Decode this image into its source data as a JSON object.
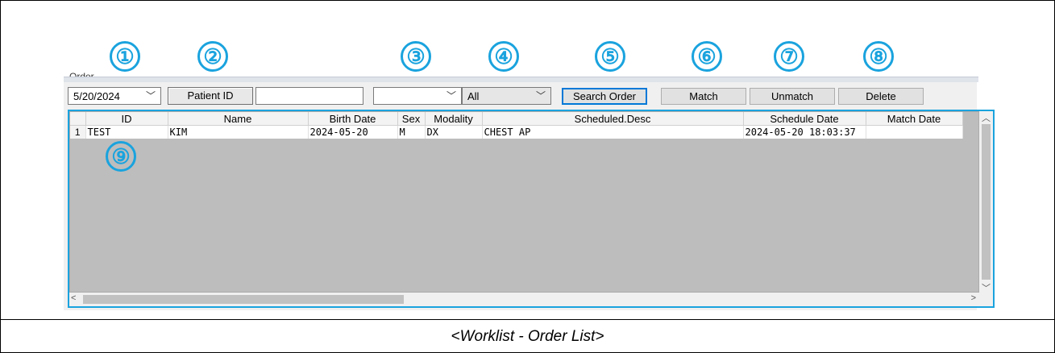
{
  "panel_title": "Order",
  "toolbar": {
    "date_value": "5/20/2024",
    "patient_id_label": "Patient ID",
    "patient_id_value": "",
    "filter1_value": "",
    "filter2_value": "All",
    "search_label": "Search Order",
    "match_label": "Match",
    "unmatch_label": "Unmatch",
    "delete_label": "Delete"
  },
  "callouts": [
    "①",
    "②",
    "③",
    "④",
    "⑤",
    "⑥",
    "⑦",
    "⑧",
    "⑨"
  ],
  "grid": {
    "columns": [
      "ID",
      "Name",
      "Birth Date",
      "Sex",
      "Modality",
      "Scheduled.Desc",
      "Schedule Date",
      "Match Date"
    ],
    "rows": [
      {
        "num": "1",
        "cells": [
          "TEST",
          "KIM",
          "2024-05-20",
          "M",
          "DX",
          "CHEST AP",
          "2024-05-20 18:03:37",
          ""
        ]
      }
    ]
  },
  "caption": "<Worklist - Order List>"
}
